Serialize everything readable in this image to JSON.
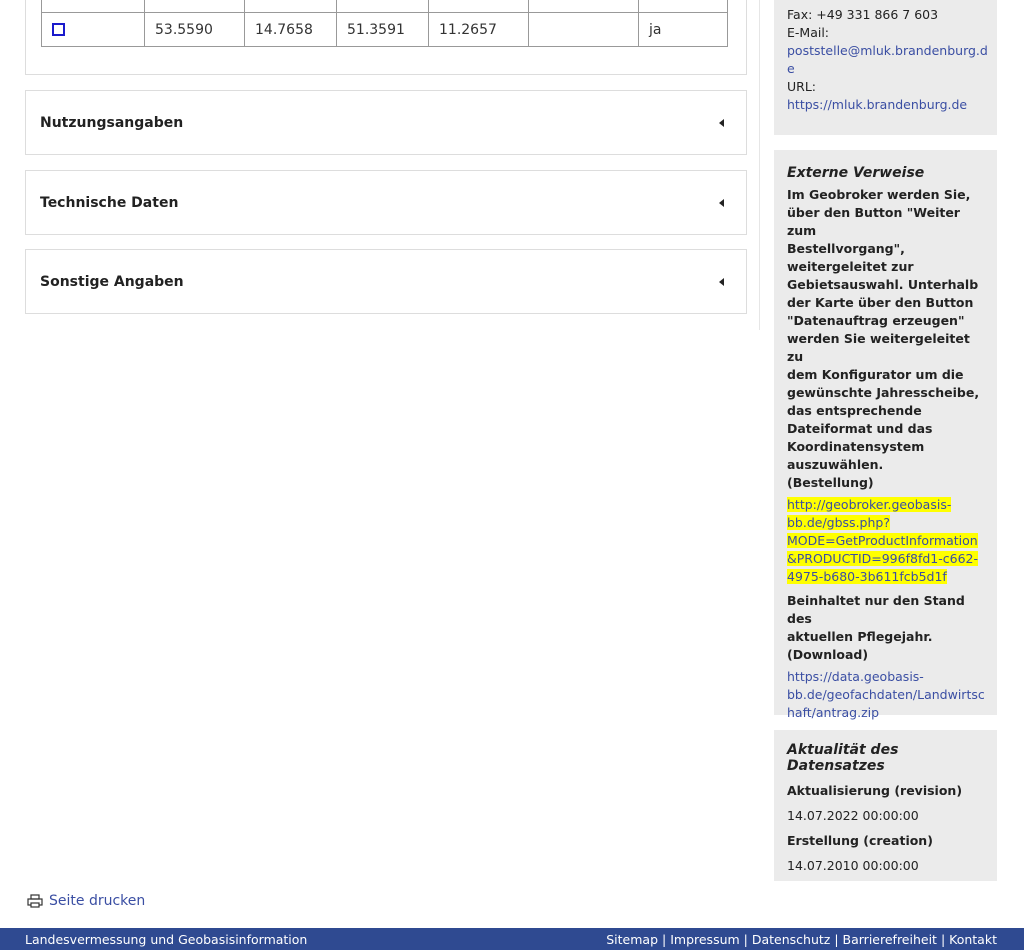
{
  "table": {
    "row": {
      "col1": "53.5590",
      "col2": "14.7658",
      "col3": "51.3591",
      "col4": "11.2657",
      "col5": "",
      "col6": "ja"
    }
  },
  "accordions": [
    {
      "title": "Nutzungsangaben"
    },
    {
      "title": "Technische Daten"
    },
    {
      "title": "Sonstige Angaben"
    }
  ],
  "contact": {
    "fax": "Fax: +49 331 866 7 603",
    "email_label": "E-Mail:",
    "email_line1": "poststelle@mluk.brandenburg.d",
    "email_line2": "e",
    "url_label": "URL:",
    "url": "https://mluk.brandenburg.de"
  },
  "external": {
    "title": "Externe Verweise",
    "text": [
      "Im Geobroker werden Sie,",
      "über den Button \"Weiter zum",
      "Bestellvorgang\",",
      "weitergeleitet zur",
      "Gebietsauswahl. Unterhalb",
      "der Karte über den Button",
      "\"Datenauftrag erzeugen\"",
      "werden Sie weitergeleitet zu",
      "dem Konfigurator um die",
      "gewünschte Jahresscheibe,",
      "das entsprechende",
      "Dateiformat und das",
      "Koordinatensystem",
      "auszuwählen.",
      "(Bestellung)"
    ],
    "link1": [
      "http://geobroker.geobasis-",
      "bb.de/gbss.php?",
      "MODE=GetProductInformation",
      "&PRODUCTID=996f8fd1-c662-",
      "4975-b680-3b611fcb5d1f"
    ],
    "text2": [
      "Beinhaltet nur den Stand des",
      "aktuellen Pflegejahr.",
      "(Download)"
    ],
    "link2": [
      "https://data.geobasis-",
      "bb.de/geofachdaten/Landwirtsc",
      "haft/antrag.zip"
    ]
  },
  "actuality": {
    "title": "Aktualität des Datensatzes",
    "revision_label": "Aktualisierung (revision)",
    "revision_value": "14.07.2022 00:00:00",
    "creation_label": "Erstellung (creation)",
    "creation_value": "14.07.2010 00:00:00"
  },
  "print": {
    "label": "Seite drucken"
  },
  "footer": {
    "left": "Landesvermessung und Geobasisinformation",
    "links": [
      "Sitemap",
      "Impressum",
      "Datenschutz",
      "Barrierefreiheit",
      "Kontakt"
    ]
  },
  "colors": {
    "link": "#3a4ea3",
    "highlight": "#ffff00",
    "footer_bg": "#2f4a91",
    "sidebar_bg": "#ebebeb"
  }
}
